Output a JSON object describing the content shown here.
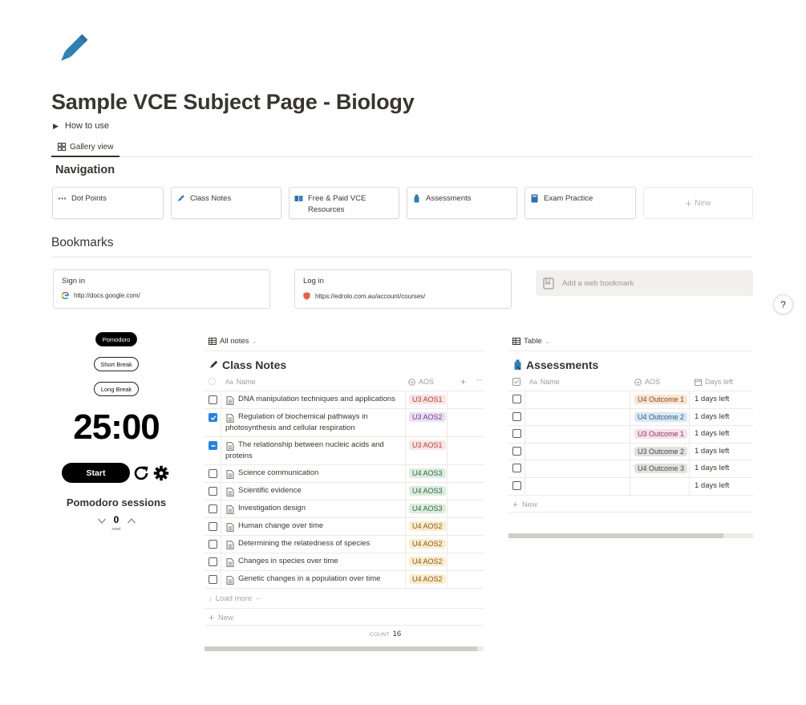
{
  "page": {
    "title": "Sample VCE Subject Page - Biology",
    "icon": "pencil-icon",
    "toggle_label": "How to use",
    "view_tab": "Gallery view"
  },
  "navigation": {
    "heading": "Navigation",
    "cards": [
      {
        "label": "Dot Points",
        "icon": "dots-icon"
      },
      {
        "label": "Class Notes",
        "icon": "pencil-icon"
      },
      {
        "label": "Free & Paid VCE Resources",
        "icon": "books-icon"
      },
      {
        "label": "Assessments",
        "icon": "bottle-icon"
      },
      {
        "label": "Exam Practice",
        "icon": "book-icon"
      }
    ],
    "new_label": "New"
  },
  "bookmarks": {
    "heading": "Bookmarks",
    "items": [
      {
        "title": "Sign in",
        "url": "http://docs.google.com/"
      },
      {
        "title": "Log in",
        "url": "https://edrolo.com.au/account/courses/"
      }
    ],
    "add_label": "Add a web bookmark"
  },
  "help_label": "?",
  "pomodoro": {
    "modes": [
      "Pomodoro",
      "Short Break",
      "Long Break"
    ],
    "active_mode": "Pomodoro",
    "timer": "25:00",
    "start_label": "Start",
    "sessions_title": "Pomodoro sessions",
    "sessions_count": "0",
    "reset_label": "reset"
  },
  "class_notes": {
    "view_label": "All notes",
    "title": "Class Notes",
    "columns": [
      "Name",
      "AOS"
    ],
    "rows": [
      {
        "name": "DNA manipulation techniques and applications",
        "aos": "U3 AOS1",
        "state": "unchecked"
      },
      {
        "name": "Regulation of biochemical pathways in photosynthesis and cellular respiration",
        "aos": "U3 AOS2",
        "state": "checked"
      },
      {
        "name": "The relationship between nucleic acids and proteins",
        "aos": "U3 AOS1",
        "state": "indeterminate"
      },
      {
        "name": "Science communication",
        "aos": "U4 AOS3",
        "state": "unchecked"
      },
      {
        "name": "Scientific evidence",
        "aos": "U4 AOS3",
        "state": "unchecked"
      },
      {
        "name": "Investigation design",
        "aos": "U4 AOS3",
        "state": "unchecked"
      },
      {
        "name": "Human change over time",
        "aos": "U4 AOS2",
        "state": "unchecked"
      },
      {
        "name": "Determining the relatedness of species",
        "aos": "U4 AOS2",
        "state": "unchecked"
      },
      {
        "name": "Changes in species over time",
        "aos": "U4 AOS2",
        "state": "unchecked"
      },
      {
        "name": "Genetic changes in a population over time",
        "aos": "U4 AOS2",
        "state": "unchecked"
      }
    ],
    "load_more": "Load more",
    "new_label": "New",
    "count_label": "COUNT",
    "count_value": "16"
  },
  "assessments": {
    "view_label": "Table",
    "title": "Assessments",
    "columns": [
      "Name",
      "AOS",
      "Days left"
    ],
    "rows": [
      {
        "aos": "U4 Outcome 1",
        "days": "1 days left"
      },
      {
        "aos": "U4 Outcome 2",
        "days": "1 days left"
      },
      {
        "aos": "U3 Outcome 1",
        "days": "1 days left"
      },
      {
        "aos": "U3 Outcome 2",
        "days": "1 days left"
      },
      {
        "aos": "U4 Outcome 3",
        "days": "1 days left"
      },
      {
        "aos": "",
        "days": "1 days left"
      }
    ],
    "new_label": "New"
  },
  "colors": {
    "U3 AOS1": {
      "bg": "#fbe4e4",
      "fg": "#b3413d"
    },
    "U3 AOS2": {
      "bg": "#ebe0f2",
      "fg": "#6f3c8f"
    },
    "U4 AOS2": {
      "bg": "#fbeccc",
      "fg": "#8a5a1c"
    },
    "U4 AOS3": {
      "bg": "#dcecdf",
      "fg": "#336b43"
    },
    "U4 Outcome 1": {
      "bg": "#f8e5d4",
      "fg": "#8a4a1a"
    },
    "U4 Outcome 2": {
      "bg": "#d8e8f3",
      "fg": "#2c5a80"
    },
    "U3 Outcome 1": {
      "bg": "#f7e0ea",
      "fg": "#8a3a5c"
    },
    "U3 Outcome 2": {
      "bg": "#e3e2e0",
      "fg": "#4a4946"
    },
    "U4 Outcome 3": {
      "bg": "#e3e2e0",
      "fg": "#4a4946"
    }
  }
}
